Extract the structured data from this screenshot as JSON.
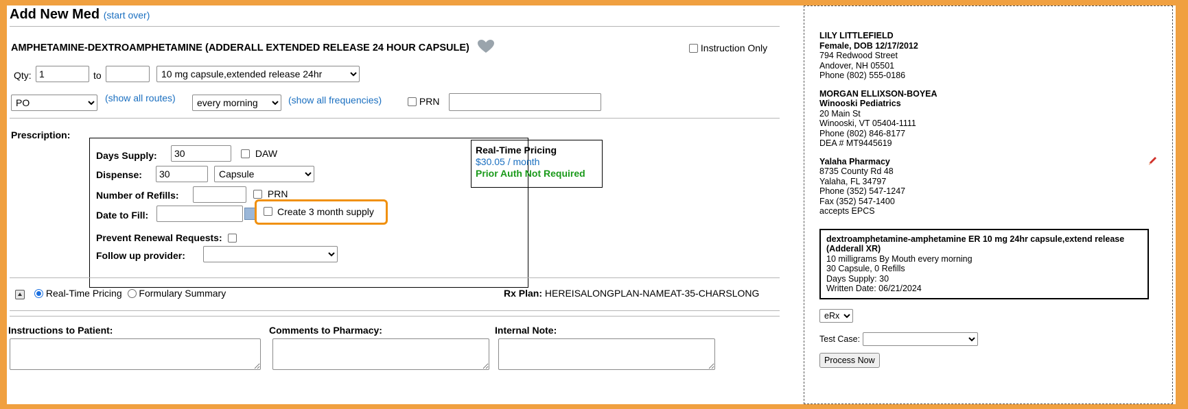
{
  "header": {
    "title": "Add New Med",
    "start_over": "(start over)"
  },
  "drug": {
    "name": "AMPHETAMINE-DEXTROAMPHETAMINE (ADDERALL EXTENDED RELEASE 24 HOUR CAPSULE)",
    "instruction_only": "Instruction Only"
  },
  "dose": {
    "qty_label": "Qty:",
    "qty_from": "1",
    "to_label": "to",
    "qty_to": "",
    "form": "10 mg capsule,extended release 24hr"
  },
  "route": {
    "value": "PO",
    "show_routes": "(show all routes)",
    "frequency": "every morning",
    "show_frequencies": "(show all frequencies)",
    "prn_label": "PRN",
    "prn_text": ""
  },
  "prescription": {
    "label": "Prescription:",
    "days_supply_label": "Days Supply:",
    "days_supply": "30",
    "daw_label": "DAW",
    "dispense_label": "Dispense:",
    "dispense": "30",
    "dispense_unit": "Capsule",
    "refills_label": "Number of Refills:",
    "refills": "",
    "refills_prn": "PRN",
    "date_label": "Date to Fill:",
    "date": "",
    "three_month": "Create 3 month supply",
    "prevent_label": "Prevent Renewal Requests:",
    "followup_label": "Follow up provider:",
    "followup": ""
  },
  "pricing": {
    "title": "Real-Time Pricing",
    "price": "$30.05 / month",
    "auth": "Prior Auth Not Required",
    "price_color": "#1a6fc0",
    "auth_color": "#1a9a1a"
  },
  "pricing_tabs": {
    "rtp": "Real-Time Pricing",
    "formulary": "Formulary Summary",
    "plan_label": "Rx Plan:",
    "plan": "HEREISALONGPLAN-NAMEAT-35-CHARSLONG"
  },
  "notes": {
    "instructions": "Instructions to Patient:",
    "comments": "Comments to Pharmacy:",
    "internal": "Internal Note:"
  },
  "patient": {
    "name": "LILY LITTLEFIELD",
    "info": "Female, DOB 12/17/2012",
    "street": "794 Redwood Street",
    "city": "Andover, NH 05501",
    "phone": "Phone (802) 555-0186"
  },
  "prescriber": {
    "name": "MORGAN ELLIXSON-BOYEA",
    "practice": "Winooski Pediatrics",
    "street": "20 Main St",
    "city": "Winooski, VT 05404-1111",
    "phone": "Phone (802) 846-8177",
    "dea": "DEA # MT9445619"
  },
  "pharmacy": {
    "name": "Yalaha Pharmacy",
    "street": "8735 County Rd 48",
    "city": "Yalaha, FL 34797",
    "phone": "Phone (352) 547-1247",
    "fax": "Fax (352) 547-1400",
    "epcs": "accepts EPCS"
  },
  "summary": {
    "drug": "dextroamphetamine-amphetamine ER 10 mg 24hr capsule,extend release (Adderall XR)",
    "sig": "10 milligrams By Mouth every morning",
    "qty": "30 Capsule, 0 Refills",
    "days": "Days Supply: 30",
    "written": "Written Date: 06/21/2024"
  },
  "actions": {
    "method": "eRx",
    "test_case_label": "Test Case:",
    "test_case": "",
    "process": "Process Now"
  }
}
